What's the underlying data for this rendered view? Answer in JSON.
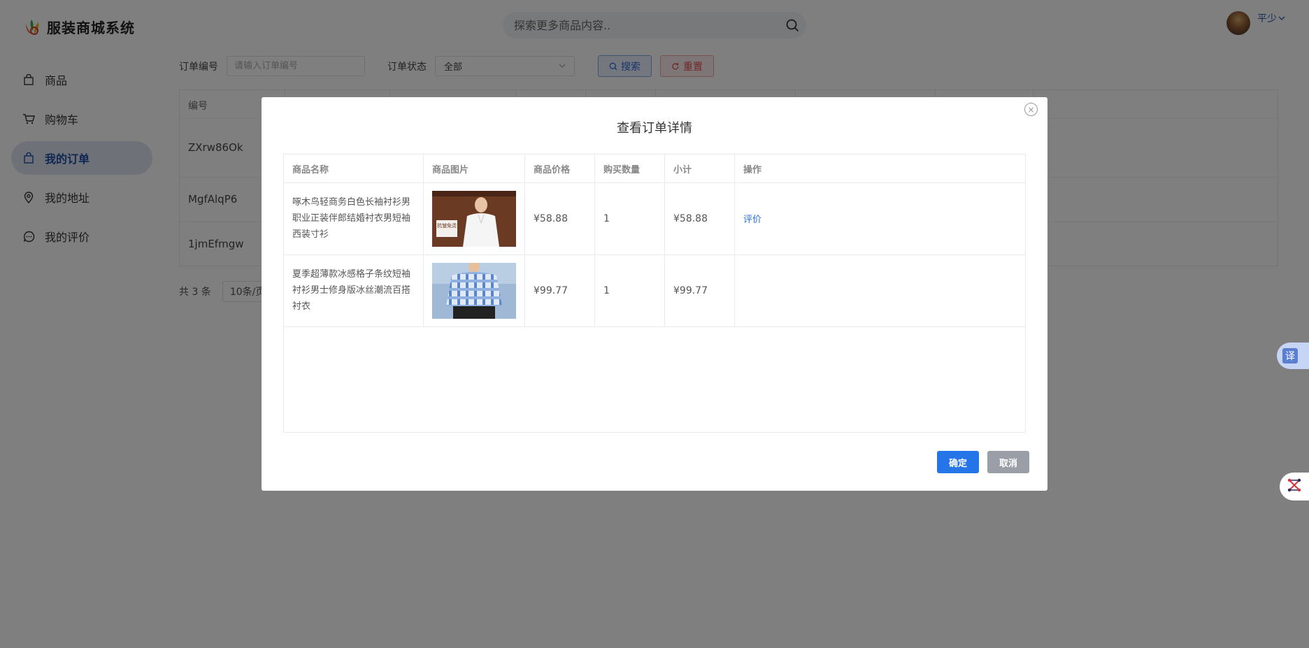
{
  "header": {
    "title": "服装商城系统",
    "search_placeholder": "探索更多商品内容..",
    "user_name": "平少"
  },
  "sidebar": {
    "items": [
      {
        "label": "商品",
        "icon": "bag-icon"
      },
      {
        "label": "购物车",
        "icon": "cart-icon"
      },
      {
        "label": "我的订单",
        "icon": "bag-icon",
        "active": true
      },
      {
        "label": "我的地址",
        "icon": "location-pin-icon"
      },
      {
        "label": "我的评价",
        "icon": "comment-icon"
      }
    ]
  },
  "filter": {
    "order_no_label": "订单编号",
    "order_no_placeholder": "请输入订单编号",
    "status_label": "订单状态",
    "status_value": "全部",
    "search_label": "搜索",
    "reset_label": "重置"
  },
  "orders_table": {
    "header_id": "编号",
    "rows": [
      "ZXrw86Ok",
      "MgfAlqP6",
      "1jmEfmgw"
    ]
  },
  "pagination": {
    "total_text": "共 3 条",
    "page_size": "10条/页"
  },
  "float": {
    "translate_label": "译"
  },
  "modal": {
    "title": "查看订单详情",
    "columns": [
      "商品名称",
      "商品图片",
      "商品价格",
      "购买数量",
      "小计",
      "操作"
    ],
    "rows": [
      {
        "name": "啄木鸟轻商务白色长袖衬衫男职业正装伴郎结婚衬衣男短袖西装寸衫",
        "img_text": "抗皱免烫",
        "price": "¥58.88",
        "qty": "1",
        "subtotal": "¥58.88",
        "action": "评价"
      },
      {
        "name": "夏季超薄款冰感格子条纹短袖衬衫男士修身版冰丝潮流百搭衬衣",
        "price": "¥99.77",
        "qty": "1",
        "subtotal": "¥99.77",
        "action": ""
      }
    ],
    "ok_label": "确定",
    "cancel_label": "取消"
  },
  "colors": {
    "primary": "#2675e8",
    "active_nav_bg": "#dde3f0",
    "reset_red": "#e05050",
    "overlay": "rgba(0,0,0,0.5)"
  }
}
